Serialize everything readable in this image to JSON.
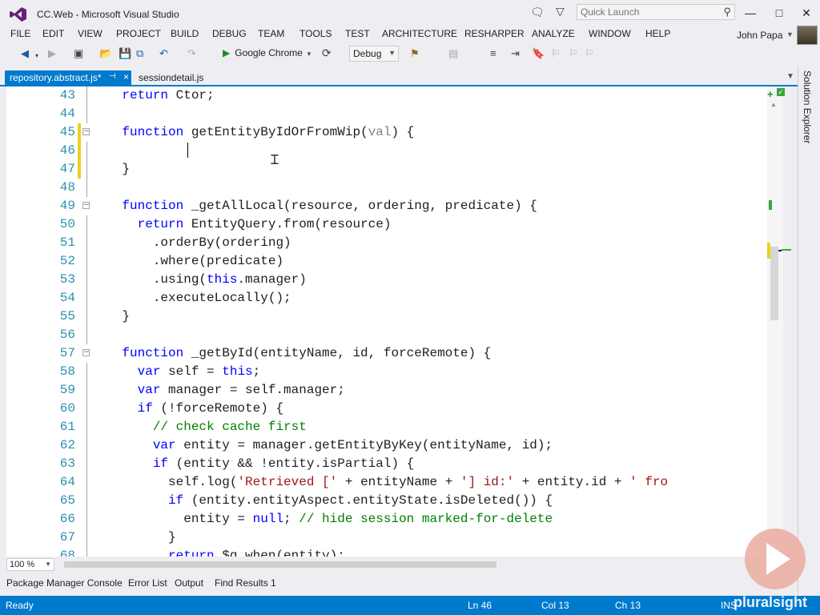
{
  "window": {
    "title": "CC.Web - Microsoft Visual Studio",
    "logo_icon": "visual-studio-logo"
  },
  "quick_launch": {
    "placeholder": "Quick Launch"
  },
  "window_controls": {
    "minimize": "—",
    "maximize": "□",
    "close": "✕"
  },
  "menu": [
    "FILE",
    "EDIT",
    "VIEW",
    "PROJECT",
    "BUILD",
    "DEBUG",
    "TEAM",
    "TOOLS",
    "TEST",
    "ARCHITECTURE",
    "RESHARPER",
    "ANALYZE",
    "WINDOW",
    "HELP"
  ],
  "user": {
    "name": "John Papa"
  },
  "toolbar": {
    "run_target": "Google Chrome",
    "configuration": "Debug"
  },
  "tabs": [
    {
      "label": "repository.abstract.js*",
      "active": true
    },
    {
      "label": "sessiondetail.js",
      "active": false
    }
  ],
  "right_rail": {
    "label": "Solution Explorer"
  },
  "editor": {
    "lines": [
      {
        "n": "43",
        "code": "return Ctor;"
      },
      {
        "n": "44",
        "code": ""
      },
      {
        "n": "45",
        "code": "function getEntityByIdOrFromWip(val) {"
      },
      {
        "n": "46",
        "code": ""
      },
      {
        "n": "47",
        "code": "}"
      },
      {
        "n": "48",
        "code": ""
      },
      {
        "n": "49",
        "code": "function _getAllLocal(resource, ordering, predicate) {"
      },
      {
        "n": "50",
        "code": "return EntityQuery.from(resource)"
      },
      {
        "n": "51",
        "code": ".orderBy(ordering)"
      },
      {
        "n": "52",
        "code": ".where(predicate)"
      },
      {
        "n": "53",
        "code": ".using(this.manager)"
      },
      {
        "n": "54",
        "code": ".executeLocally();"
      },
      {
        "n": "55",
        "code": "}"
      },
      {
        "n": "56",
        "code": ""
      },
      {
        "n": "57",
        "code": "function _getById(entityName, id, forceRemote) {"
      },
      {
        "n": "58",
        "code": "var self = this;"
      },
      {
        "n": "59",
        "code": "var manager = self.manager;"
      },
      {
        "n": "60",
        "code": "if (!forceRemote) {"
      },
      {
        "n": "61",
        "code": "// check cache first"
      },
      {
        "n": "62",
        "code": "var entity = manager.getEntityByKey(entityName, id);"
      },
      {
        "n": "63",
        "code": "if (entity && !entity.isPartial) {"
      },
      {
        "n": "64",
        "code": "self.log('Retrieved [' + entityName + '] id:' + entity.id + ' fro"
      },
      {
        "n": "65",
        "code": "if (entity.entityAspect.entityState.isDeleted()) {"
      },
      {
        "n": "66",
        "code": "entity = null; // hide session marked-for-delete"
      },
      {
        "n": "67",
        "code": "}"
      },
      {
        "n": "68",
        "code": "return $q.when(entity);"
      }
    ],
    "zoom": "100 %"
  },
  "bottom_tabs": [
    "Package Manager Console",
    "Error List",
    "Output",
    "Find Results 1"
  ],
  "status": {
    "state": "Ready",
    "line": "Ln 46",
    "col": "Col 13",
    "ch": "Ch 13",
    "mode": "INS"
  },
  "watermark": "pluralsight",
  "colors": {
    "accent": "#007acc",
    "keyword": "#0000ff",
    "string": "#a31515",
    "comment": "#008000",
    "line_number": "#2b91af",
    "change_marker": "#e8d221"
  }
}
